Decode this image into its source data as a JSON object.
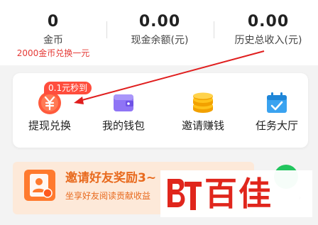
{
  "stats": {
    "coins": {
      "value": "0",
      "label": "金币",
      "sub": "2000金币兑换一元"
    },
    "cash_balance": {
      "value": "0.00",
      "label": "现金余额(元)"
    },
    "total_income": {
      "value": "0.00",
      "label": "历史总收入(元)"
    }
  },
  "features": [
    {
      "label": "提现兑换",
      "icon": "yuan-coin-icon",
      "badge": "0.1元秒到"
    },
    {
      "label": "我的钱包",
      "icon": "wallet-icon"
    },
    {
      "label": "邀请赚钱",
      "icon": "coin-stack-icon"
    },
    {
      "label": "任务大厅",
      "icon": "calendar-check-icon"
    }
  ],
  "banner": {
    "title": "邀请好友奖励3~",
    "subtitle": "坐享好友阅读贡献收益"
  },
  "watermark": {
    "text": "百佳",
    "logo_letters": "BT"
  },
  "colors": {
    "accent_red": "#e53935",
    "badge_red": "#ff4d3d",
    "banner_orange": "#e86a1e",
    "banner_bg": "#fde9d9",
    "green": "#22c55e",
    "watermark_red": "#e0261c"
  }
}
